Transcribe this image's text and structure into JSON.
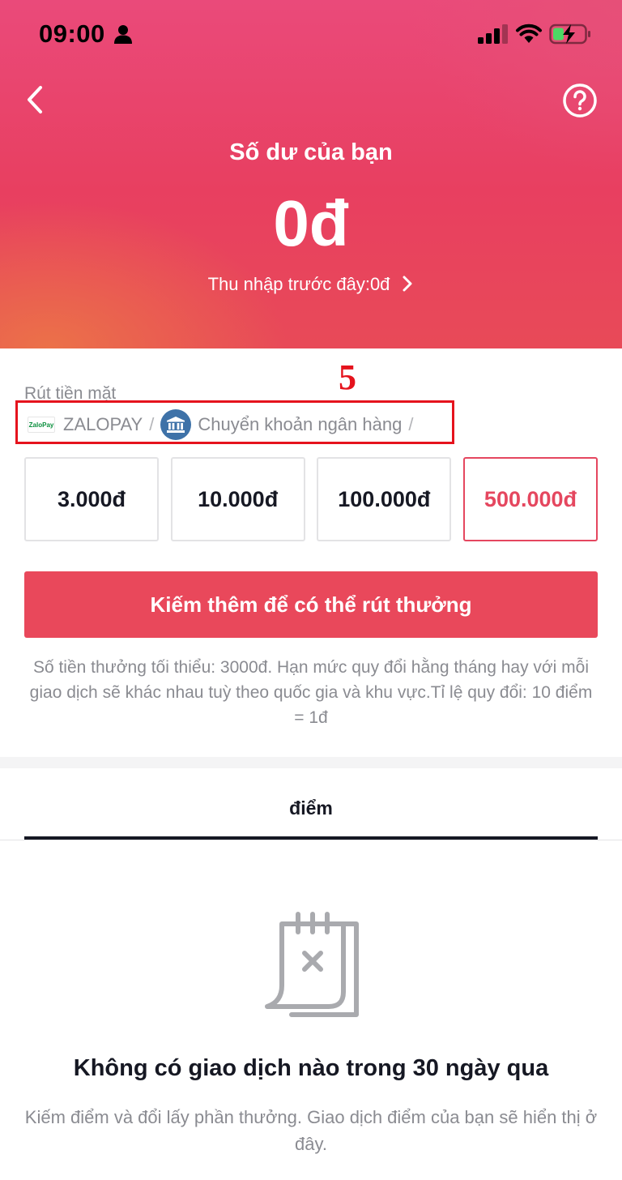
{
  "status_bar": {
    "time": "09:00"
  },
  "header": {
    "title": "Số dư của bạn",
    "balance": "0đ",
    "previous_income": "Thu nhập trước đây:0đ"
  },
  "annotation": {
    "step_number": "5"
  },
  "withdraw": {
    "label": "Rút tiền mặt",
    "methods": [
      {
        "logo_text": "ZaloPay",
        "name": "ZALOPAY",
        "separator": "/"
      },
      {
        "name": "Chuyển khoản ngân hàng",
        "separator": "/"
      }
    ],
    "amounts": [
      {
        "label": "3.000đ",
        "selected": false
      },
      {
        "label": "10.000đ",
        "selected": false
      },
      {
        "label": "100.000đ",
        "selected": false
      },
      {
        "label": "500.000đ",
        "selected": true
      }
    ],
    "button_label": "Kiếm thêm để có thể rút thưởng",
    "note": "Số tiền thưởng tối thiểu: 3000đ. Hạn mức quy đổi hằng tháng hay với mỗi giao dịch sẽ khác nhau tuỳ theo quốc gia và khu vực.Tỉ lệ quy đổi: 10 điểm = 1đ"
  },
  "tabs": [
    {
      "label": "điểm",
      "active": true
    }
  ],
  "empty_state": {
    "title": "Không có giao dịch nào trong 30 ngày qua",
    "description": "Kiếm điểm và đổi lấy phần thưởng. Giao dịch điểm của bạn sẽ hiển thị ở đây."
  },
  "colors": {
    "accent": "#e9485b",
    "annotation_red": "#e5131d",
    "muted_text": "#8a8b91"
  }
}
